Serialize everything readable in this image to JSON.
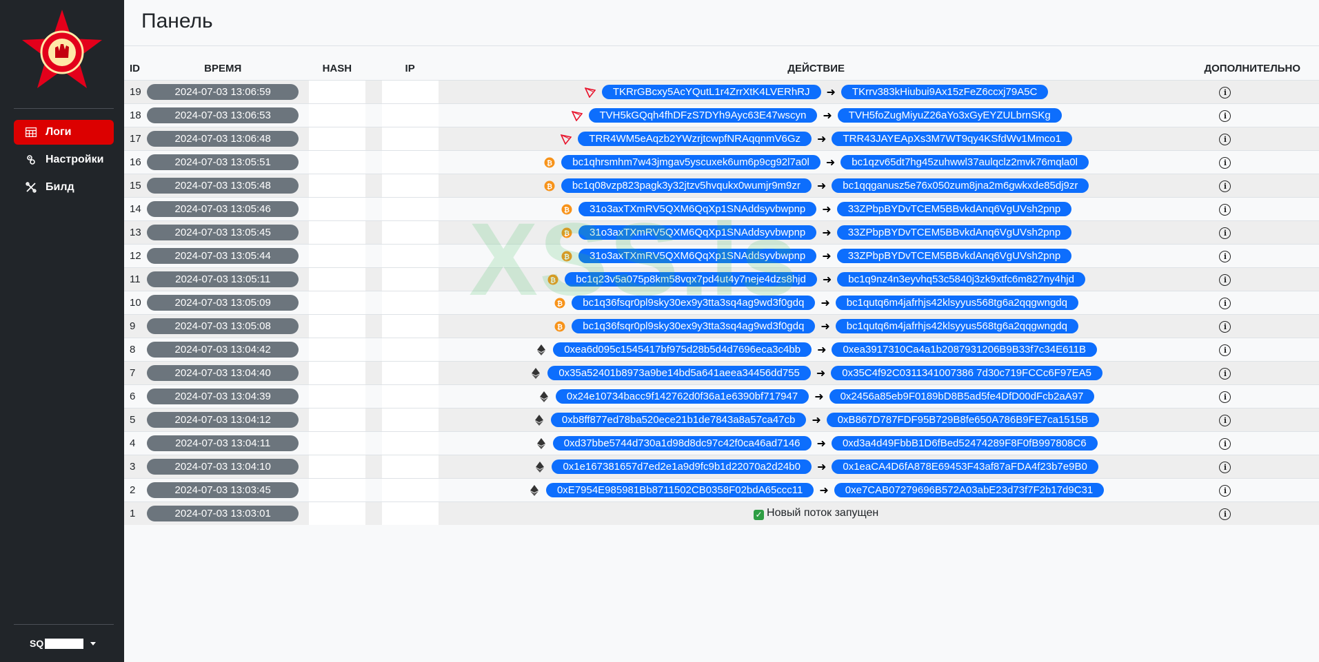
{
  "sidebar": {
    "nav": [
      {
        "label": "Логи",
        "icon": "table-icon",
        "active": true
      },
      {
        "label": "Настройки",
        "icon": "settings-icon",
        "active": false
      },
      {
        "label": "Билд",
        "icon": "tools-icon",
        "active": false
      }
    ],
    "user": {
      "name": "SQ"
    }
  },
  "main": {
    "title": "Панель",
    "columns": {
      "id": "ID",
      "time": "ВРЕМЯ",
      "hash": "HASH",
      "ip": "IP",
      "action": "ДЕЙСТВИЕ",
      "more": "ДОПОЛНИТЕЛЬНО"
    },
    "rows": [
      {
        "id": "19",
        "time": "2024-07-03 13:06:59",
        "coin": "tron",
        "from": "TKRrGBcxy5AcYQutL1r4ZrrXtK4LVERhRJ",
        "to": "TKrrv383kHiubui9Ax15zFeZ6ccxj79A5C"
      },
      {
        "id": "18",
        "time": "2024-07-03 13:06:53",
        "coin": "tron",
        "from": "TVH5kGQqh4fhDFzS7DYh9Ayc63E47wscyn",
        "to": "TVH5foZugMiyuZ26aYo3xGyEYZULbrnSKg"
      },
      {
        "id": "17",
        "time": "2024-07-03 13:06:48",
        "coin": "tron",
        "from": "TRR4WM5eAqzb2YWzrjtcwpfNRAqqnmV6Gz",
        "to": "TRR43JAYEApXs3M7WT9qy4KSfdWv1Mmco1"
      },
      {
        "id": "16",
        "time": "2024-07-03 13:05:51",
        "coin": "btc",
        "from": "bc1qhrsmhm7w43jmgav5yscuxek6um6p9cg92l7a0l",
        "to": "bc1qzv65dt7hg45zuhwwl37aulqclz2mvk76mqla0l"
      },
      {
        "id": "15",
        "time": "2024-07-03 13:05:48",
        "coin": "btc",
        "from": "bc1q08vzp823pagk3y32jtzv5hvqukx0wumjr9m9zr",
        "to": "bc1qqganusz5e76x050zum8jna2m6gwkxde85dj9zr"
      },
      {
        "id": "14",
        "time": "2024-07-03 13:05:46",
        "coin": "btc",
        "from": "31o3axTXmRV5QXM6QqXp1SNAddsyvbwpnp",
        "to": "33ZPbpBYDvTCEM5BBvkdAnq6VgUVsh2pnp"
      },
      {
        "id": "13",
        "time": "2024-07-03 13:05:45",
        "coin": "btc",
        "from": "31o3axTXmRV5QXM6QqXp1SNAddsyvbwpnp",
        "to": "33ZPbpBYDvTCEM5BBvkdAnq6VgUVsh2pnp"
      },
      {
        "id": "12",
        "time": "2024-07-03 13:05:44",
        "coin": "btc",
        "from": "31o3axTXmRV5QXM6QqXp1SNAddsyvbwpnp",
        "to": "33ZPbpBYDvTCEM5BBvkdAnq6VgUVsh2pnp"
      },
      {
        "id": "11",
        "time": "2024-07-03 13:05:11",
        "coin": "btc",
        "from": "bc1q23v5a075p8km58vqx7pd4ut4y7neje4dzs8hjd",
        "to": "bc1q9nz4n3eyvhq53c5840j3zk9xtfc6m827ny4hjd"
      },
      {
        "id": "10",
        "time": "2024-07-03 13:05:09",
        "coin": "btc",
        "from": "bc1q36fsqr0pl9sky30ex9y3tta3sq4ag9wd3f0gdq",
        "to": "bc1qutq6m4jafrhjs42klsyyus568tg6a2qqgwngdq"
      },
      {
        "id": "9",
        "time": "2024-07-03 13:05:08",
        "coin": "btc",
        "from": "bc1q36fsqr0pl9sky30ex9y3tta3sq4ag9wd3f0gdq",
        "to": "bc1qutq6m4jafrhjs42klsyyus568tg6a2qqgwngdq"
      },
      {
        "id": "8",
        "time": "2024-07-03 13:04:42",
        "coin": "eth",
        "from": "0xea6d095c1545417bf975d28b5d4d7696eca3c4bb",
        "to": "0xea3917310Ca4a1b2087931206B9B33f7c34E611B"
      },
      {
        "id": "7",
        "time": "2024-07-03 13:04:40",
        "coin": "eth",
        "from": "0x35a52401b8973a9be14bd5a641aeea34456dd755",
        "to": "0x35C4f92C0311341007386 7d30c719FCCc6F97EA5"
      },
      {
        "id": "6",
        "time": "2024-07-03 13:04:39",
        "coin": "eth",
        "from": "0x24e10734bacc9f142762d0f36a1e6390bf717947",
        "to": "0x2456a85eb9F0189bD8B5ad5fe4DfD00dFcb2aA97"
      },
      {
        "id": "5",
        "time": "2024-07-03 13:04:12",
        "coin": "eth",
        "from": "0xb8ff877ed78ba520ece21b1de7843a8a57ca47cb",
        "to": "0xB867D787FDF95B729B8fe650A786B9FE7ca1515B"
      },
      {
        "id": "4",
        "time": "2024-07-03 13:04:11",
        "coin": "eth",
        "from": "0xd37bbe5744d730a1d98d8dc97c42f0ca46ad7146",
        "to": "0xd3a4d49FbbB1D6fBed52474289F8F0fB997808C6"
      },
      {
        "id": "3",
        "time": "2024-07-03 13:04:10",
        "coin": "eth",
        "from": "0x1e167381657d7ed2e1a9d9fc9b1d22070a2d24b0",
        "to": "0x1eaCA4D6fA878E69453F43af87aFDA4f23b7e9B0"
      },
      {
        "id": "2",
        "time": "2024-07-03 13:03:45",
        "coin": "eth",
        "from": "0xE7954E985981Bb8711502CB0358F02bdA65ccc11",
        "to": "0xe7CAB07279696B572A03abE23d73f7F2b17d9C31"
      },
      {
        "id": "1",
        "time": "2024-07-03 13:03:01",
        "coin": "none",
        "message": "Новый поток запущен"
      }
    ],
    "arrow": "➜",
    "info": "i"
  },
  "watermark": "XSS.is",
  "colors": {
    "sidebar": "#212529",
    "accent": "#dc0000",
    "pill": "#0d6efd",
    "time_badge": "#6c757d"
  }
}
